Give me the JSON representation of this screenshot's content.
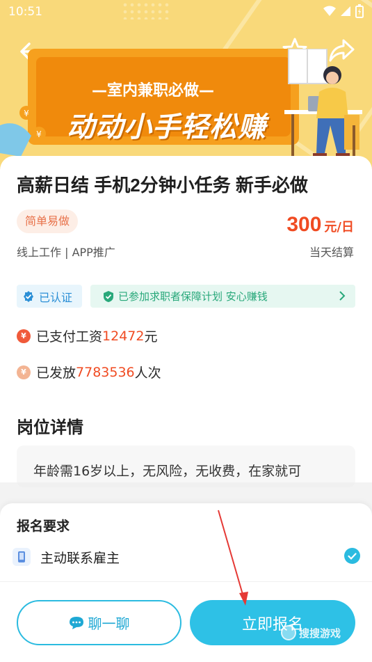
{
  "status_bar": {
    "time": "10:51"
  },
  "hero": {
    "banner_subtitle": "—室内兼职必做—",
    "banner_title": "动动小手轻松赚"
  },
  "job": {
    "title": "高薪日结 手机2分钟小任务 新手必做",
    "tag": "简单易做",
    "salary_amount": "300",
    "salary_unit": "元/日",
    "type": "线上工作 | APP推广",
    "settlement": "当天结算"
  },
  "badges": {
    "verified": "已认证",
    "guarantee": "已参加求职者保障计划 安心赚钱"
  },
  "stats": {
    "paid_prefix": "已支付工资",
    "paid_amount": "12472",
    "paid_suffix": "元",
    "issued_prefix": "已发放",
    "issued_count": "7783536",
    "issued_suffix": "人次"
  },
  "details": {
    "section_title": "岗位详情",
    "text": "年龄需16岁以上，无风险，无收费，在家就可"
  },
  "sheet": {
    "title": "报名要求",
    "requirement": "主动联系雇主",
    "chat_label": "聊一聊",
    "apply_label": "立即报名"
  },
  "watermark": {
    "text": "搜搜游戏"
  },
  "colors": {
    "accent": "#2ec1e6",
    "price": "#f04b22",
    "hero_bg": "#f9d97a",
    "banner": "#f08a0c"
  },
  "icons": [
    "back-arrow-icon",
    "star-icon",
    "share-icon",
    "verified-shield-icon",
    "guarantee-shield-icon",
    "chevron-right-icon",
    "money-bag-icon",
    "coin-icon",
    "phone-icon",
    "check-icon",
    "chat-bubble-icon"
  ]
}
